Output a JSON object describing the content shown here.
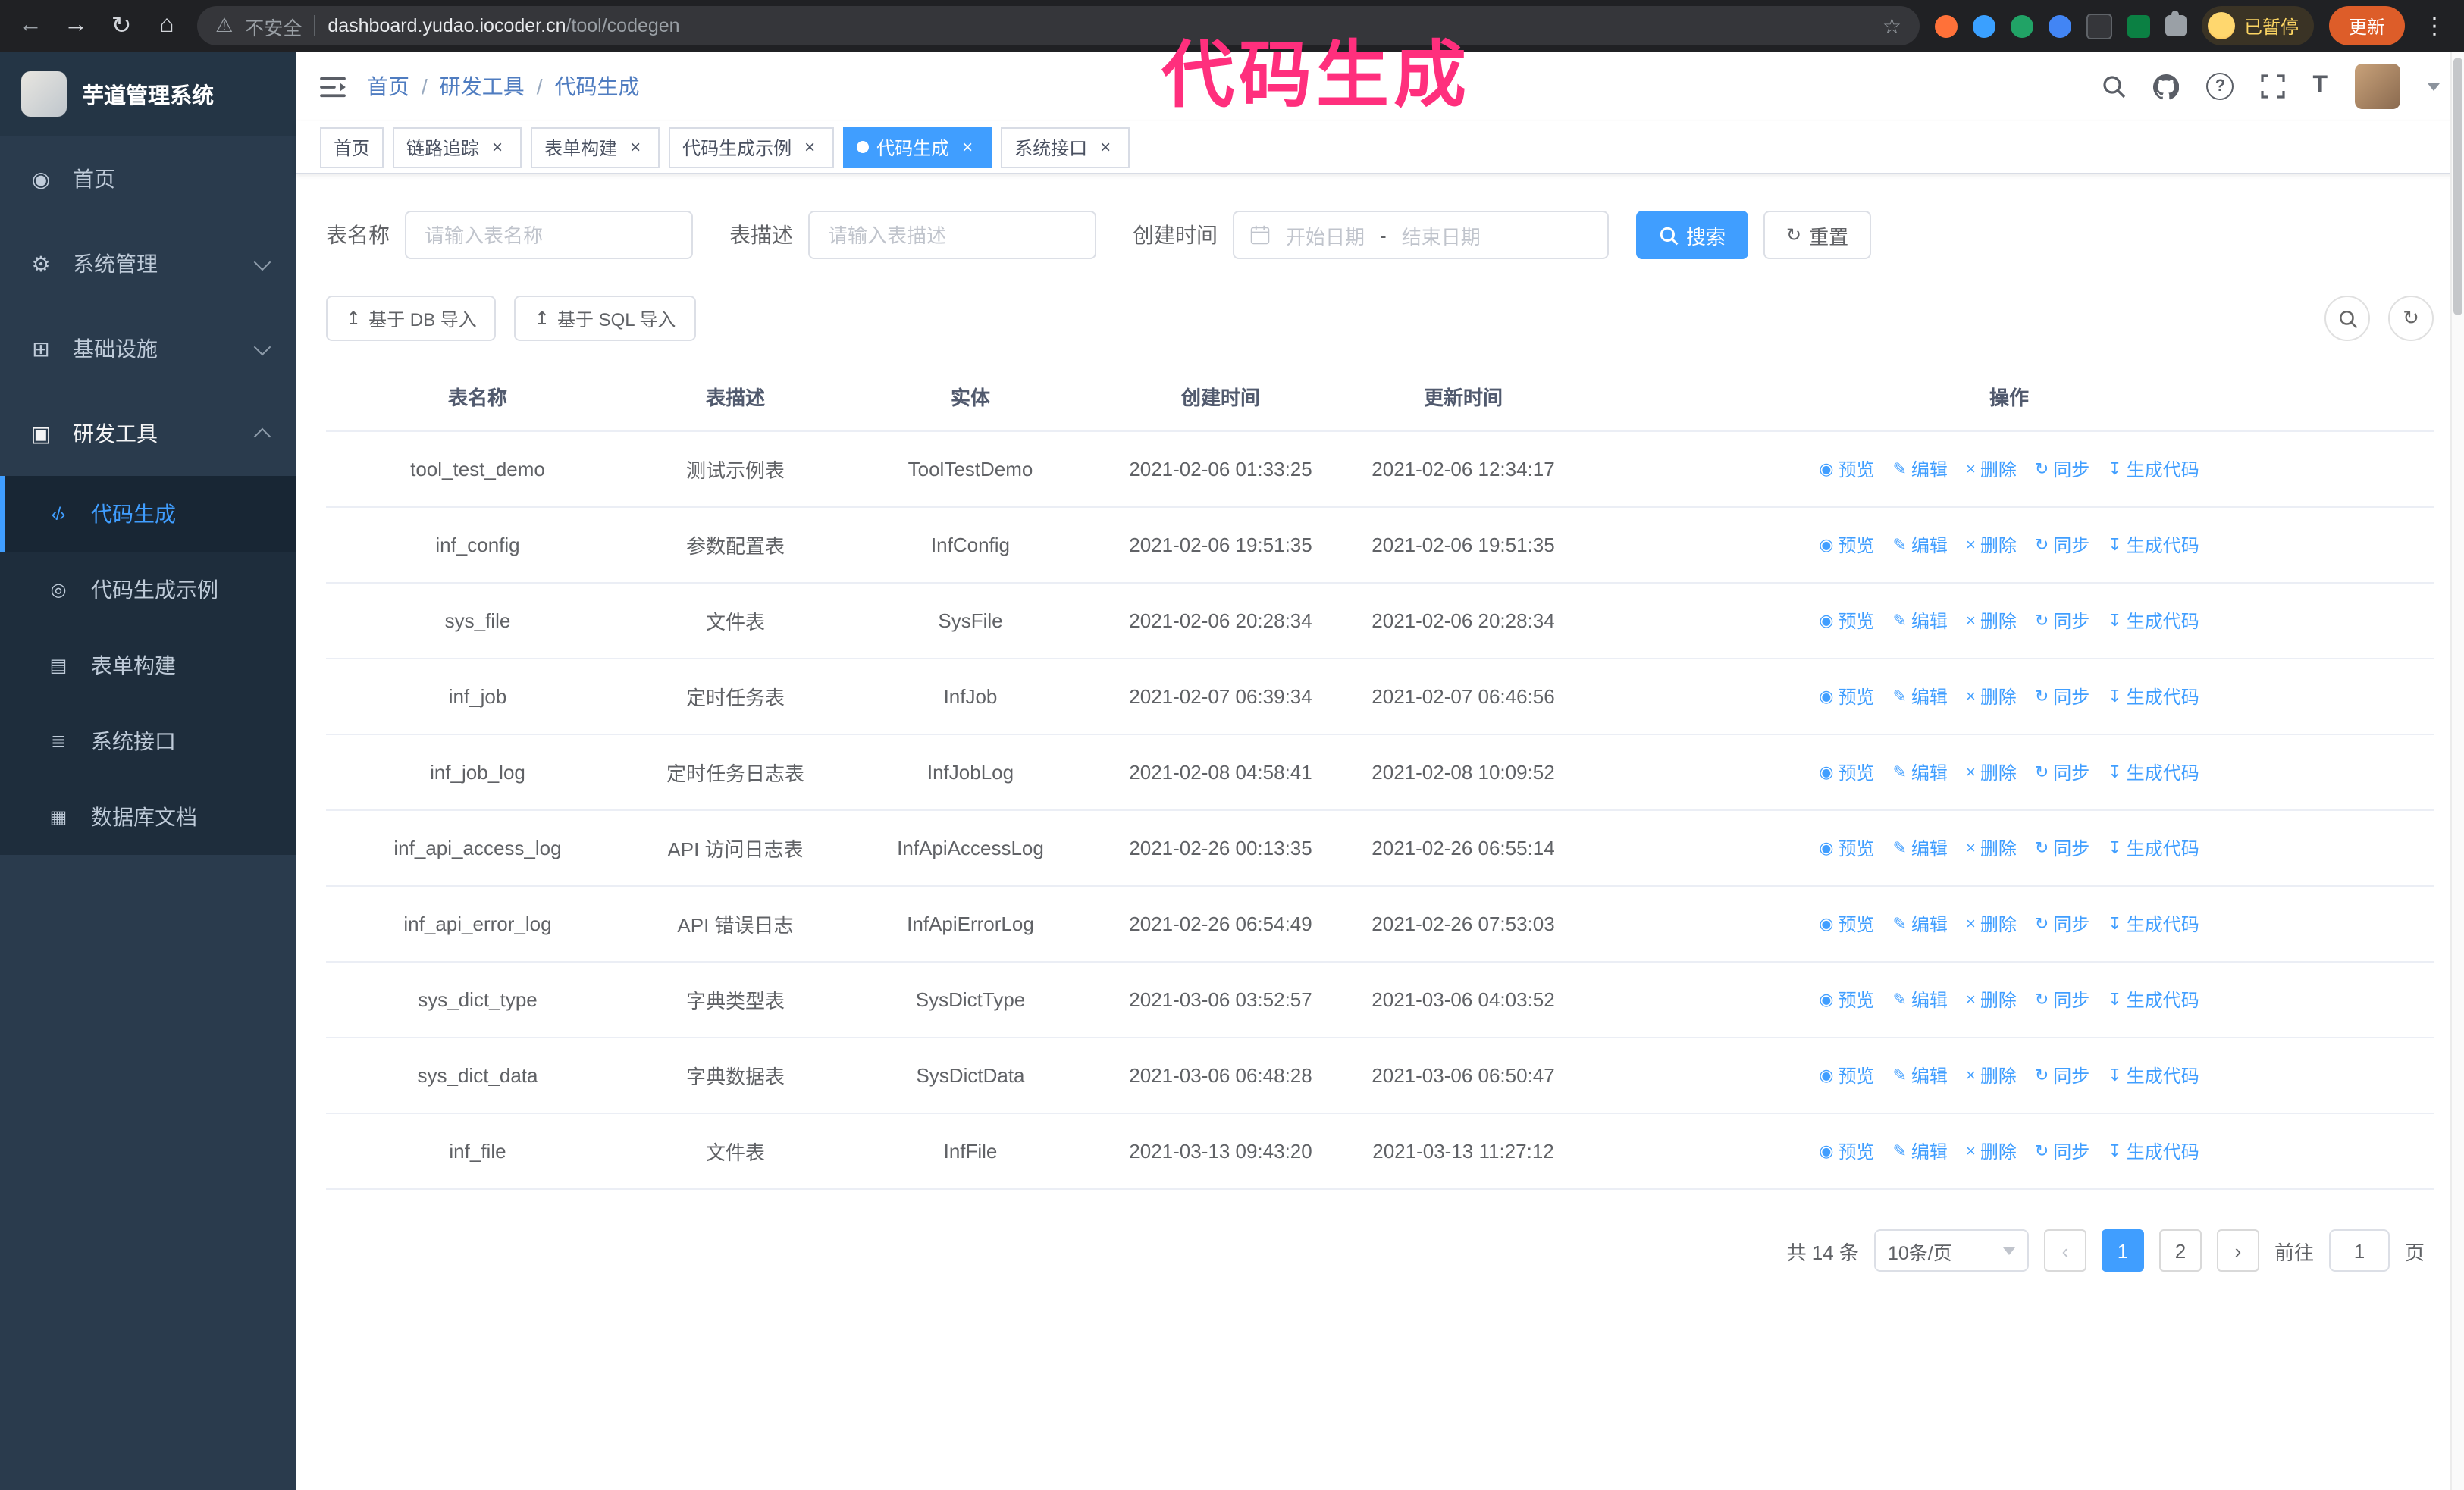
{
  "browser": {
    "security_label": "不安全",
    "url_host": "dashboard.yudao.iocoder.cn",
    "url_path": "/tool/codegen",
    "profile_badge": "已暂停",
    "update_button": "更新"
  },
  "annotation": {
    "text": "代码生成",
    "color": "#ff2f7d"
  },
  "ui": {
    "icons": {
      "back": "←",
      "forward": "→",
      "reload": "↻",
      "home": "⌂",
      "warning": "⚠",
      "star": "☆",
      "kebab": "⋮",
      "help": "?",
      "font_size": "T",
      "close": "×",
      "prev": "‹",
      "next": "›",
      "upload": "↥",
      "refresh": "↻"
    }
  },
  "sidebar": {
    "logo_title": "芋道管理系统",
    "items": [
      {
        "icon": "◉",
        "label": "首页"
      },
      {
        "icon": "⚙",
        "label": "系统管理"
      },
      {
        "icon": "⊞",
        "label": "基础设施"
      },
      {
        "icon": "▣",
        "label": "研发工具"
      }
    ],
    "submenu": [
      {
        "icon": "‹/›",
        "label": "代码生成"
      },
      {
        "icon": "◎",
        "label": "代码生成示例"
      },
      {
        "icon": "▤",
        "label": "表单构建"
      },
      {
        "icon": "≣",
        "label": "系统接口"
      },
      {
        "icon": "▦",
        "label": "数据库文档"
      }
    ]
  },
  "header": {
    "breadcrumb": {
      "items": [
        "首页",
        "研发工具",
        "代码生成"
      ],
      "separator": "/"
    }
  },
  "tabs": [
    {
      "label": "首页",
      "closable": false,
      "active": false
    },
    {
      "label": "链路追踪",
      "closable": true,
      "active": false
    },
    {
      "label": "表单构建",
      "closable": true,
      "active": false
    },
    {
      "label": "代码生成示例",
      "closable": true,
      "active": false
    },
    {
      "label": "代码生成",
      "closable": true,
      "active": true
    },
    {
      "label": "系统接口",
      "closable": true,
      "active": false
    }
  ],
  "filters": {
    "table_name_label": "表名称",
    "table_name_placeholder": "请输入表名称",
    "table_desc_label": "表描述",
    "table_desc_placeholder": "请输入表描述",
    "create_time_label": "创建时间",
    "date_start_placeholder": "开始日期",
    "date_separator": "-",
    "date_end_placeholder": "结束日期",
    "search_button": "搜索",
    "reset_button": "重置"
  },
  "toolbar": {
    "import_db_button": "基于 DB 导入",
    "import_sql_button": "基于 SQL 导入"
  },
  "table": {
    "columns": [
      "表名称",
      "表描述",
      "实体",
      "创建时间",
      "更新时间",
      "操作"
    ],
    "actions": [
      "预览",
      "编辑",
      "删除",
      "同步",
      "生成代码"
    ],
    "action_icons": [
      "◉",
      "✎",
      "×",
      "↻",
      "↧"
    ],
    "rows": [
      {
        "name": "tool_test_demo",
        "desc": "测试示例表",
        "entity": "ToolTestDemo",
        "created": "2021-02-06 01:33:25",
        "updated": "2021-02-06 12:34:17"
      },
      {
        "name": "inf_config",
        "desc": "参数配置表",
        "entity": "InfConfig",
        "created": "2021-02-06 19:51:35",
        "updated": "2021-02-06 19:51:35"
      },
      {
        "name": "sys_file",
        "desc": "文件表",
        "entity": "SysFile",
        "created": "2021-02-06 20:28:34",
        "updated": "2021-02-06 20:28:34"
      },
      {
        "name": "inf_job",
        "desc": "定时任务表",
        "entity": "InfJob",
        "created": "2021-02-07 06:39:34",
        "updated": "2021-02-07 06:46:56"
      },
      {
        "name": "inf_job_log",
        "desc": "定时任务日志表",
        "entity": "InfJobLog",
        "created": "2021-02-08 04:58:41",
        "updated": "2021-02-08 10:09:52"
      },
      {
        "name": "inf_api_access_log",
        "desc": "API 访问日志表",
        "entity": "InfApiAccessLog",
        "created": "2021-02-26 00:13:35",
        "updated": "2021-02-26 06:55:14"
      },
      {
        "name": "inf_api_error_log",
        "desc": "API 错误日志",
        "entity": "InfApiErrorLog",
        "created": "2021-02-26 06:54:49",
        "updated": "2021-02-26 07:53:03"
      },
      {
        "name": "sys_dict_type",
        "desc": "字典类型表",
        "entity": "SysDictType",
        "created": "2021-03-06 03:52:57",
        "updated": "2021-03-06 04:03:52"
      },
      {
        "name": "sys_dict_data",
        "desc": "字典数据表",
        "entity": "SysDictData",
        "created": "2021-03-06 06:48:28",
        "updated": "2021-03-06 06:50:47"
      },
      {
        "name": "inf_file",
        "desc": "文件表",
        "entity": "InfFile",
        "created": "2021-03-13 09:43:20",
        "updated": "2021-03-13 11:27:12"
      }
    ]
  },
  "pagination": {
    "total_text": "共 14 条",
    "page_size": "10条/页",
    "page_1": "1",
    "page_2": "2",
    "current_page": "1",
    "goto_label": "前往",
    "goto_value": "1",
    "goto_suffix": "页"
  },
  "colors": {
    "primary": "#409eff",
    "sidebar_bg": "#2a3b4d",
    "submenu_bg": "#1e2d3c",
    "annotation_pink": "#ff2f7d",
    "chrome_bar": "#202124"
  }
}
